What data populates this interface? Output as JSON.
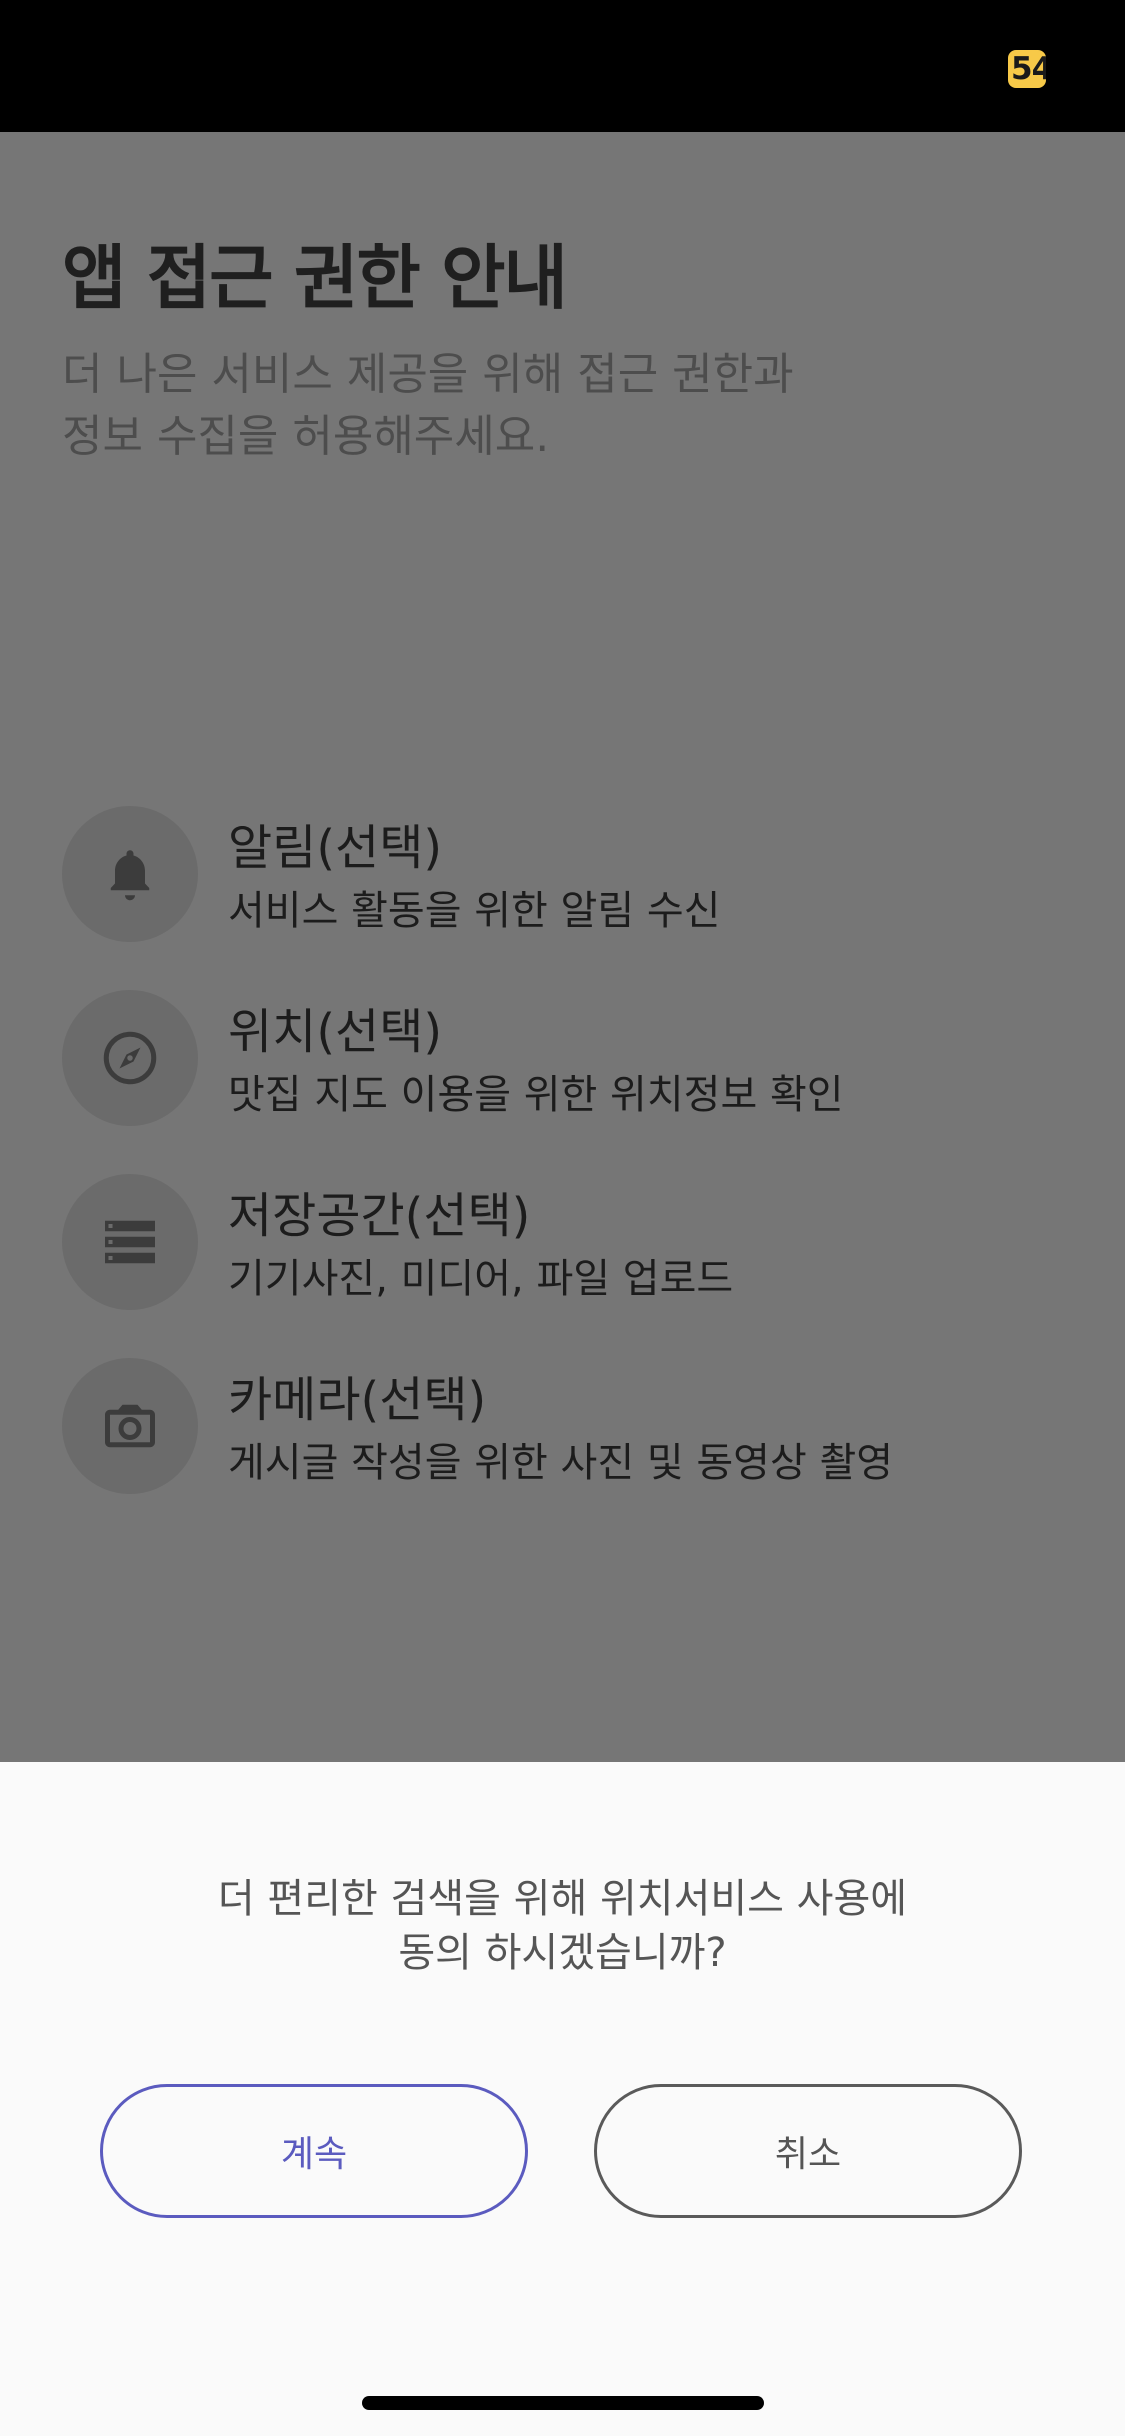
{
  "status_bar": {
    "battery_text": "54"
  },
  "screen": {
    "title": "앱 접근 권한 안내",
    "subtitle": "더 나은 서비스 제공을 위해 접근 권한과\n정보 수집을 허용해주세요.",
    "permissions": [
      {
        "icon": "bell-icon",
        "title": "알림(선택)",
        "desc": "서비스 활동을 위한 알림 수신"
      },
      {
        "icon": "compass-icon",
        "title": "위치(선택)",
        "desc": "맛집 지도 이용을 위한 위치정보 확인"
      },
      {
        "icon": "storage-icon",
        "title": "저장공간(선택)",
        "desc": "기기사진, 미디어, 파일 업로드"
      },
      {
        "icon": "camera-icon",
        "title": "카메라(선택)",
        "desc": "게시글 작성을 위한 사진 및 동영상 촬영"
      }
    ]
  },
  "dialog": {
    "message": "더 편리한 검색을 위해 위치서비스 사용에\n동의 하시겠습니까?",
    "continue_label": "계속",
    "cancel_label": "취소"
  },
  "colors": {
    "overlay": "#767676",
    "icon_circle": "#6b6b6b",
    "accent": "#5b5bbf",
    "battery": "#f7c948"
  }
}
